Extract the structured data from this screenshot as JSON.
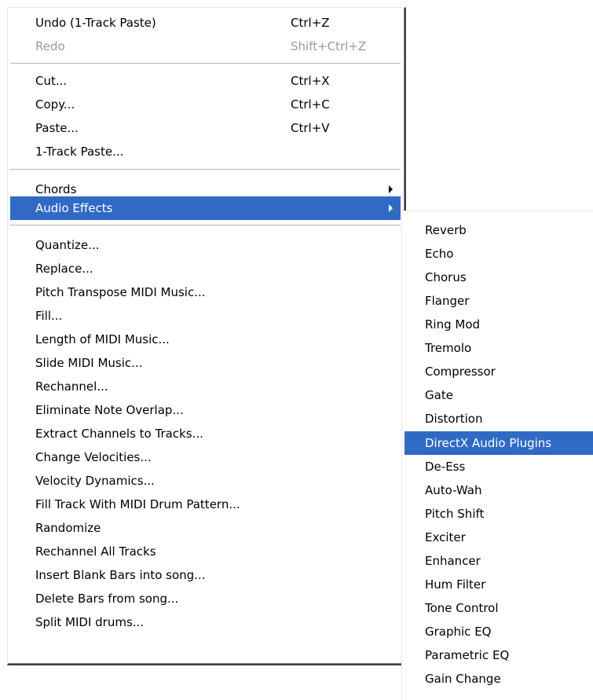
{
  "main_menu": {
    "items": [
      {
        "label": "Undo (1-Track Paste)",
        "shortcut": "Ctrl+Z"
      },
      {
        "label": "Redo",
        "shortcut": "Shift+Ctrl+Z",
        "disabled": true
      },
      {
        "label": "Cut...",
        "shortcut": "Ctrl+X"
      },
      {
        "label": "Copy...",
        "shortcut": "Ctrl+C"
      },
      {
        "label": "Paste...",
        "shortcut": "Ctrl+V"
      },
      {
        "label": "1-Track Paste..."
      },
      {
        "label": "Chords"
      },
      {
        "label": "Audio Effects",
        "highlighted": true
      },
      {
        "label": "Quantize..."
      },
      {
        "label": "Replace..."
      },
      {
        "label": "Pitch Transpose MIDI Music..."
      },
      {
        "label": "Fill..."
      },
      {
        "label": "Length of MIDI Music..."
      },
      {
        "label": "Slide MIDI Music..."
      },
      {
        "label": "Rechannel..."
      },
      {
        "label": "Eliminate Note Overlap..."
      },
      {
        "label": "Extract Channels to Tracks..."
      },
      {
        "label": "Change Velocities..."
      },
      {
        "label": "Velocity Dynamics..."
      },
      {
        "label": "Fill Track With MIDI Drum Pattern..."
      },
      {
        "label": "Randomize"
      },
      {
        "label": "Rechannel All Tracks"
      },
      {
        "label": "Insert Blank Bars into song..."
      },
      {
        "label": "Delete Bars from song..."
      },
      {
        "label": "Split MIDI drums..."
      }
    ]
  },
  "audio_effects_submenu": {
    "items": [
      {
        "label": "Reverb"
      },
      {
        "label": "Echo"
      },
      {
        "label": "Chorus"
      },
      {
        "label": "Flanger"
      },
      {
        "label": "Ring Mod"
      },
      {
        "label": "Tremolo"
      },
      {
        "label": "Compressor"
      },
      {
        "label": "Gate"
      },
      {
        "label": "Distortion"
      },
      {
        "label": "DirectX Audio Plugins",
        "highlighted": true
      },
      {
        "label": "De-Ess"
      },
      {
        "label": "Auto-Wah"
      },
      {
        "label": "Pitch Shift"
      },
      {
        "label": "Exciter"
      },
      {
        "label": "Enhancer"
      },
      {
        "label": "Hum Filter"
      },
      {
        "label": "Tone Control"
      },
      {
        "label": "Graphic EQ"
      },
      {
        "label": "Parametric EQ"
      },
      {
        "label": "Gain Change"
      }
    ]
  },
  "colors": {
    "highlight_bg": "#316ac5",
    "highlight_text": "#ffffff",
    "disabled_text": "#9a9a9a"
  }
}
